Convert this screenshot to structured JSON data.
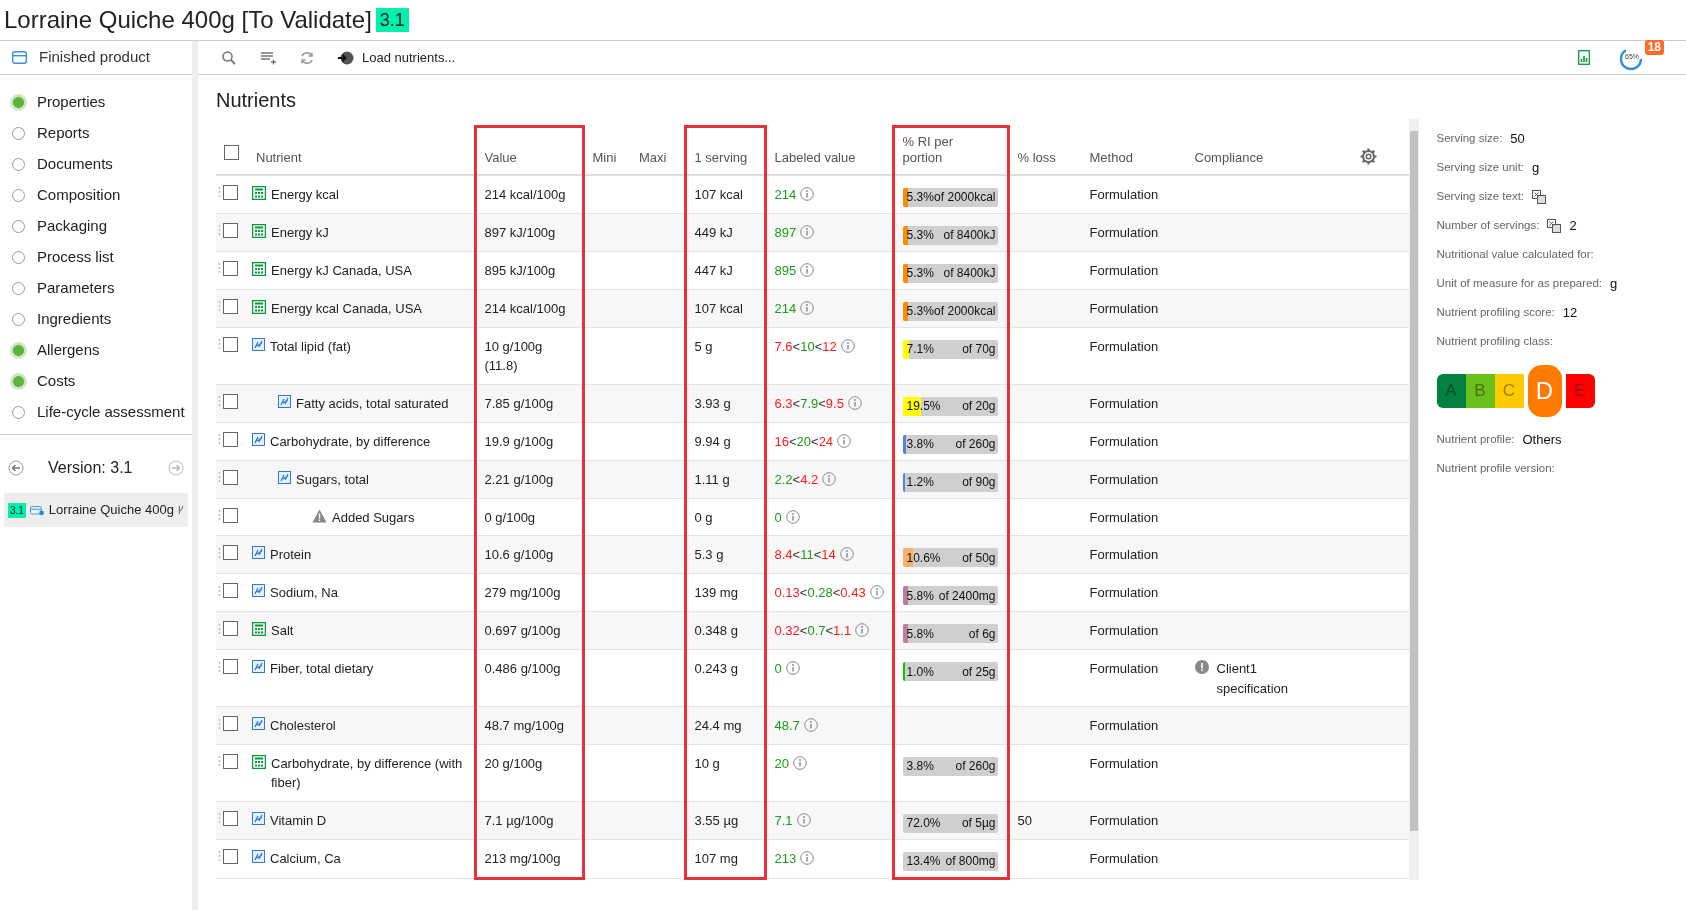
{
  "header": {
    "title": "Lorraine Quiche 400g [To Validate]",
    "version_badge": "3.1"
  },
  "sidebar": {
    "title": "Finished product",
    "items": [
      {
        "label": "Properties",
        "done": true
      },
      {
        "label": "Reports",
        "done": false
      },
      {
        "label": "Documents",
        "done": false
      },
      {
        "label": "Composition",
        "done": false
      },
      {
        "label": "Packaging",
        "done": false
      },
      {
        "label": "Process list",
        "done": false
      },
      {
        "label": "Parameters",
        "done": false
      },
      {
        "label": "Ingredients",
        "done": false
      },
      {
        "label": "Allergens",
        "done": true
      },
      {
        "label": "Costs",
        "done": true
      },
      {
        "label": "Life-cycle assessment",
        "done": false
      }
    ],
    "version": "Version: 3.1",
    "tree_item": {
      "badge": "3.1",
      "label": "Lorraine Quiche 400g"
    }
  },
  "toolbar": {
    "load_button": "Load nutrients...",
    "progress": "65%",
    "notifications": "18"
  },
  "section_title": "Nutrients",
  "table": {
    "select_all_checked": false,
    "columns": [
      {
        "label": "Nutrient",
        "highlighted": false
      },
      {
        "label": "Value",
        "highlighted": true
      },
      {
        "label": "Mini",
        "highlighted": false
      },
      {
        "label": "Maxi",
        "highlighted": false
      },
      {
        "label": "1 serving",
        "highlighted": true
      },
      {
        "label": "Labeled value",
        "highlighted": false
      },
      {
        "label": "% RI per portion",
        "highlighted": true
      },
      {
        "label": "% loss",
        "highlighted": false
      },
      {
        "label": "Method",
        "highlighted": false
      },
      {
        "label": "Compliance",
        "highlighted": false
      }
    ],
    "rows": [
      {
        "name": "Energy kcal",
        "kind": "calculated",
        "checked": false,
        "value": "214 kcal/100g",
        "serving": "107 kcal",
        "labeled": [
          {
            "text": "214",
            "kind": "ok"
          }
        ],
        "ri": {
          "percent": "5.3%",
          "of": "of 2000kcal",
          "level": 0.053,
          "color": "#ff8c00"
        },
        "method": "Formulation"
      },
      {
        "name": "Energy kJ",
        "kind": "calculated",
        "checked": false,
        "value": "897 kJ/100g",
        "serving": "449 kJ",
        "labeled": [
          {
            "text": "897",
            "kind": "ok"
          }
        ],
        "ri": {
          "percent": "5.3%",
          "of": "of 8400kJ",
          "level": 0.053,
          "color": "#ff8c00"
        },
        "method": "Formulation"
      },
      {
        "name": "Energy kJ Canada, USA",
        "kind": "calculated",
        "checked": false,
        "value": "895 kJ/100g",
        "serving": "447 kJ",
        "labeled": [
          {
            "text": "895",
            "kind": "ok"
          }
        ],
        "ri": {
          "percent": "5.3%",
          "of": "of 8400kJ",
          "level": 0.053,
          "color": "#ff8c00"
        },
        "method": "Formulation"
      },
      {
        "name": "Energy kcal Canada, USA",
        "kind": "calculated",
        "checked": false,
        "value": "214 kcal/100g",
        "serving": "107 kcal",
        "labeled": [
          {
            "text": "214",
            "kind": "ok"
          }
        ],
        "ri": {
          "percent": "5.3%",
          "of": "of 2000kcal",
          "level": 0.053,
          "color": "#ff8c00"
        },
        "method": "Formulation"
      },
      {
        "name": "Total lipid (fat)",
        "kind": "formula",
        "checked": false,
        "value": "10 g/100g  (11.8)",
        "serving": "5 g",
        "labeled": [
          {
            "text": "7.6",
            "kind": "bad"
          },
          {
            "text": "<",
            "kind": "sep"
          },
          {
            "text": "10",
            "kind": "ok"
          },
          {
            "text": "<",
            "kind": "sep"
          },
          {
            "text": "12",
            "kind": "bad"
          }
        ],
        "ri": {
          "percent": "7.1%",
          "of": "of 70g",
          "level": 0.071,
          "color": "#ffff00"
        },
        "method": "Formulation",
        "children": [
          {
            "name": "Fatty acids, total saturated",
            "kind": "formula",
            "checked": false,
            "value": "7.85 g/100g",
            "serving": "3.93 g",
            "labeled": [
              {
                "text": "6.3",
                "kind": "bad"
              },
              {
                "text": "<",
                "kind": "sep"
              },
              {
                "text": "7.9",
                "kind": "ok"
              },
              {
                "text": "<",
                "kind": "sep"
              },
              {
                "text": "9.5",
                "kind": "bad"
              }
            ],
            "ri": {
              "percent": "19.5%",
              "of": "of 20g",
              "level": 0.195,
              "color": "#ffff00"
            },
            "method": "Formulation"
          }
        ]
      },
      {
        "name": "Carbohydrate, by difference",
        "kind": "formula",
        "checked": false,
        "value": "19.9 g/100g",
        "serving": "9.94 g",
        "labeled": [
          {
            "text": "16",
            "kind": "bad"
          },
          {
            "text": "<",
            "kind": "sep"
          },
          {
            "text": "20",
            "kind": "ok"
          },
          {
            "text": "<",
            "kind": "sep"
          },
          {
            "text": "24",
            "kind": "bad"
          }
        ],
        "ri": {
          "percent": "3.8%",
          "of": "of 260g",
          "level": 0.038,
          "color": "#4a86e8"
        },
        "method": "Formulation",
        "children": [
          {
            "name": "Sugars, total",
            "kind": "formula",
            "checked": false,
            "value": "2.21 g/100g",
            "serving": "1.11 g",
            "labeled": [
              {
                "text": "2.2",
                "kind": "ok"
              },
              {
                "text": "<",
                "kind": "sep"
              },
              {
                "text": "4.2",
                "kind": "bad"
              }
            ],
            "ri": {
              "percent": "1.2%",
              "of": "of 90g",
              "level": 0.012,
              "color": "#4a86e8"
            },
            "method": "Formulation",
            "children": [
              {
                "name": "Added Sugars",
                "kind": "warning",
                "checked": false,
                "value": "0 g/100g",
                "serving": "0 g",
                "labeled": [
                  {
                    "text": "0",
                    "kind": "ok"
                  }
                ],
                "method": "Formulation"
              }
            ]
          }
        ]
      },
      {
        "name": "Protein",
        "kind": "formula",
        "checked": false,
        "value": "10.6 g/100g",
        "serving": "5.3 g",
        "labeled": [
          {
            "text": "8.4",
            "kind": "bad"
          },
          {
            "text": "<",
            "kind": "sep"
          },
          {
            "text": "11",
            "kind": "ok"
          },
          {
            "text": "<",
            "kind": "sep"
          },
          {
            "text": "14",
            "kind": "bad"
          }
        ],
        "ri": {
          "percent": "10.6%",
          "of": "of 50g",
          "level": 0.106,
          "color": "#f6b26b"
        },
        "method": "Formulation"
      },
      {
        "name": "Sodium, Na",
        "kind": "formula",
        "checked": false,
        "value": "279 mg/100g",
        "serving": "139 mg",
        "labeled": [
          {
            "text": "0.13",
            "kind": "bad"
          },
          {
            "text": "<",
            "kind": "sep"
          },
          {
            "text": "0.28",
            "kind": "ok"
          },
          {
            "text": "<",
            "kind": "sep"
          },
          {
            "text": "0.43",
            "kind": "bad"
          }
        ],
        "ri": {
          "percent": "5.8%",
          "of": "of 2400mg",
          "level": 0.058,
          "color": "#c27ba0"
        },
        "method": "Formulation"
      },
      {
        "name": "Salt",
        "kind": "calculated",
        "checked": false,
        "value": "0.697 g/100g",
        "serving": "0.348 g",
        "labeled": [
          {
            "text": "0.32",
            "kind": "bad"
          },
          {
            "text": "<",
            "kind": "sep"
          },
          {
            "text": "0.7",
            "kind": "ok"
          },
          {
            "text": "<",
            "kind": "sep"
          },
          {
            "text": "1.1",
            "kind": "bad"
          }
        ],
        "ri": {
          "percent": "5.8%",
          "of": "of 6g",
          "level": 0.058,
          "color": "#c27ba0"
        },
        "method": "Formulation"
      },
      {
        "name": "Fiber, total dietary",
        "kind": "formula",
        "checked": false,
        "value": "0.486 g/100g",
        "serving": "0.243 g",
        "labeled": [
          {
            "text": "0",
            "kind": "ok"
          }
        ],
        "ri": {
          "percent": "1.0%",
          "of": "of 25g",
          "level": 0.01,
          "color": "#00cc00"
        },
        "method": "Formulation",
        "compliance": "Client1 specification"
      },
      {
        "name": "Cholesterol",
        "kind": "formula",
        "checked": false,
        "value": "48.7 mg/100g",
        "serving": "24.4 mg",
        "labeled": [
          {
            "text": "48.7",
            "kind": "ok"
          }
        ],
        "method": "Formulation"
      },
      {
        "name": "Carbohydrate, by difference (with fiber)",
        "kind": "calculated",
        "checked": false,
        "value": "20 g/100g",
        "serving": "10 g",
        "labeled": [
          {
            "text": "20",
            "kind": "ok"
          }
        ],
        "ri": {
          "percent": "3.8%",
          "of": "of 260g"
        },
        "method": "Formulation"
      },
      {
        "name": "Vitamin D",
        "kind": "formula",
        "checked": false,
        "value": "7.1 µg/100g",
        "serving": "3.55 µg",
        "labeled": [
          {
            "text": "7.1",
            "kind": "ok"
          }
        ],
        "ri": {
          "percent": "72.0%",
          "of": "of 5µg"
        },
        "loss": "50",
        "method": "Formulation"
      },
      {
        "name": "Calcium, Ca",
        "kind": "formula",
        "checked": false,
        "value": "213 mg/100g",
        "serving": "107 mg",
        "labeled": [
          {
            "text": "213",
            "kind": "ok"
          }
        ],
        "ri": {
          "percent": "13.4%",
          "of": "of 800mg"
        },
        "method": "Formulation"
      }
    ]
  },
  "details": {
    "fields": [
      {
        "label": "Serving size:",
        "value": "50"
      },
      {
        "label": "Serving size unit:",
        "value": "g"
      },
      {
        "label": "Serving size text:",
        "translatable": true
      },
      {
        "label": "Number of servings:",
        "value": "2",
        "translatable": true
      },
      {
        "label": "Nutritional value calculated for:"
      },
      {
        "label": "Unit of measure for as prepared:",
        "value": "g"
      },
      {
        "label": "Nutrient profiling score:",
        "value": "12"
      },
      {
        "label": "Nutrient profiling class:"
      }
    ],
    "classes": [
      {
        "letter": "A",
        "color": "#038141",
        "selected": false
      },
      {
        "letter": "B",
        "color": "#6cc01e",
        "selected": false
      },
      {
        "letter": "C",
        "color": "#fecb02",
        "selected": false
      },
      {
        "letter": "D",
        "color": "#ff7a00",
        "selected": true
      },
      {
        "letter": "E",
        "color": "#ff0000",
        "selected": false
      }
    ],
    "after_fields": [
      {
        "label": "Nutrient profile:",
        "value": "Others"
      },
      {
        "label": "Nutrient profile version:"
      }
    ]
  }
}
